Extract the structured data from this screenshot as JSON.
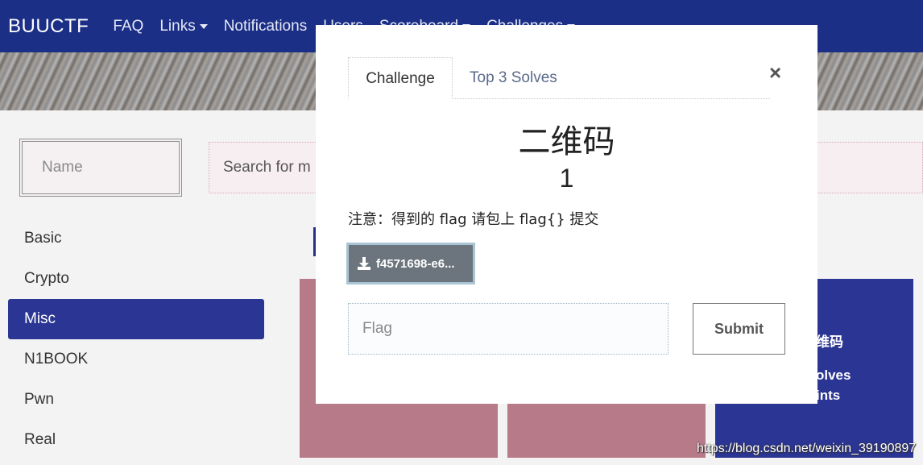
{
  "navbar": {
    "brand": "BUUCTF",
    "items": [
      {
        "label": "FAQ",
        "dropdown": false
      },
      {
        "label": "Links",
        "dropdown": true
      },
      {
        "label": "Notifications",
        "dropdown": false
      },
      {
        "label": "Users",
        "dropdown": false
      },
      {
        "label": "Scoreboard",
        "dropdown": true
      },
      {
        "label": "Challenges",
        "dropdown": true
      }
    ]
  },
  "filters": {
    "name_placeholder": "Name",
    "search_placeholder": "Search for m"
  },
  "sidebar": {
    "items": [
      {
        "label": "Basic",
        "active": false
      },
      {
        "label": "Crypto",
        "active": false
      },
      {
        "label": "Misc",
        "active": true
      },
      {
        "label": "N1BOOK",
        "active": false
      },
      {
        "label": "Pwn",
        "active": false
      },
      {
        "label": "Real",
        "active": false
      }
    ]
  },
  "background_card": {
    "title_fragment": "维码",
    "solves_fragment": "olves",
    "points_fragment": "ints"
  },
  "modal": {
    "tabs": [
      "Challenge",
      "Top 3 Solves"
    ],
    "close_label": "×",
    "title": "二维码",
    "value": "1",
    "description": "注意：得到的 flag 请包上 flag{} 提交",
    "file_label": "f4571698-e6...",
    "flag_placeholder": "Flag",
    "submit_label": "Submit"
  },
  "watermark": "https://blog.csdn.net/weixin_39190897",
  "colors": {
    "navbar": "#1b2f86",
    "active_category": "#2b3593",
    "card_pink": "#b77a89",
    "file_button": "#6c757d"
  }
}
